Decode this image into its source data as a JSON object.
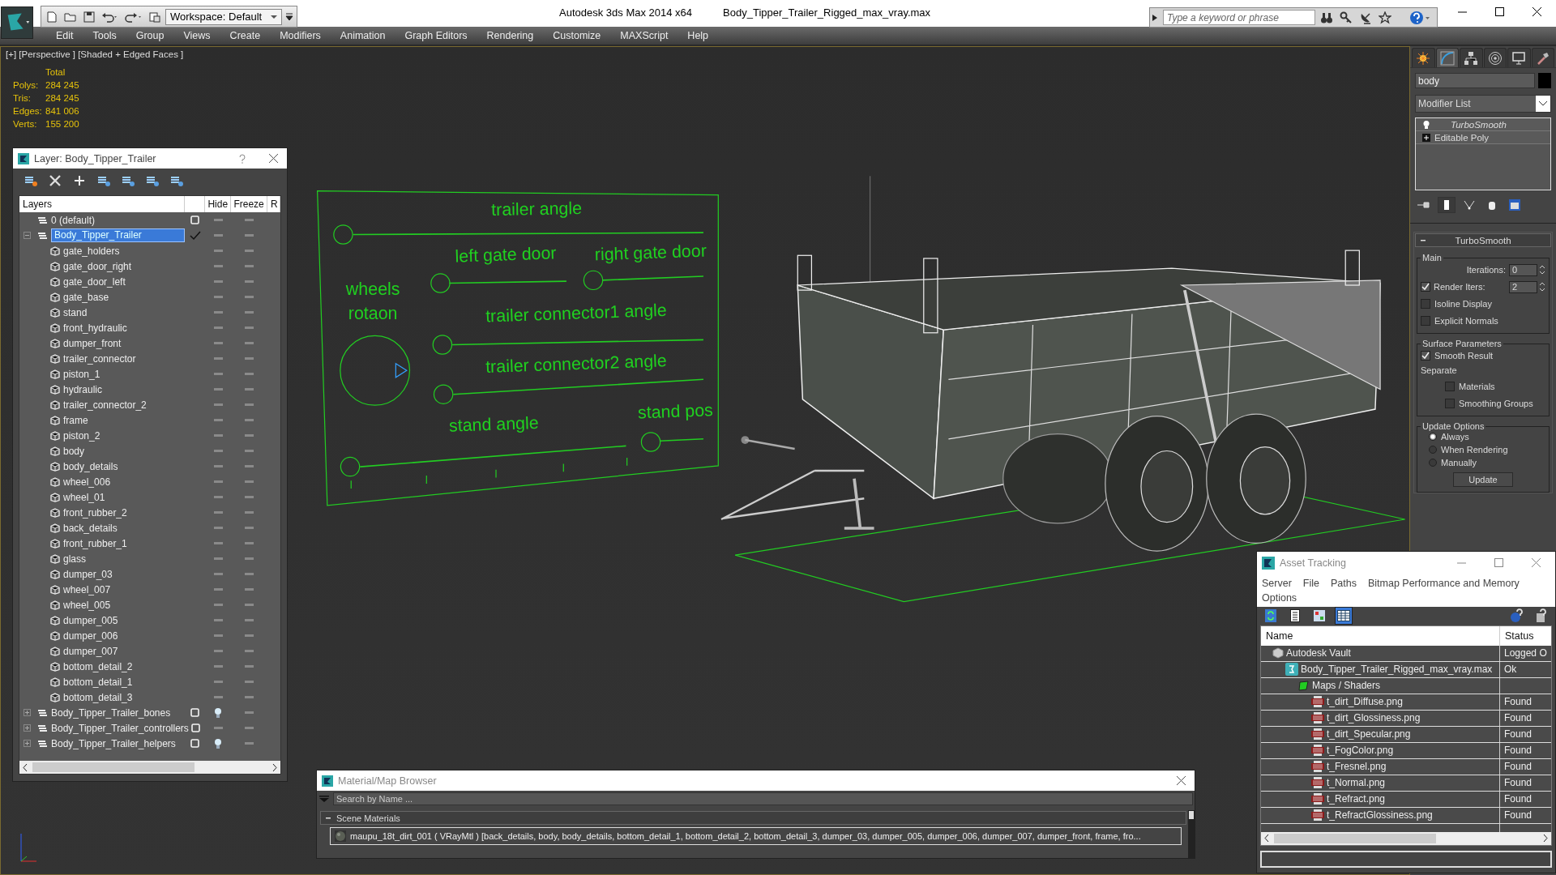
{
  "title_bar": {
    "workspace": "Workspace: Default",
    "app_title": "Autodesk 3ds Max  2014 x64",
    "file_name": "Body_Tipper_Trailer_Rigged_max_vray.max",
    "search_placeholder": "Type a keyword or phrase"
  },
  "menu": [
    "Edit",
    "Tools",
    "Group",
    "Views",
    "Create",
    "Modifiers",
    "Animation",
    "Graph Editors",
    "Rendering",
    "Customize",
    "MAXScript",
    "Help"
  ],
  "viewport": {
    "label": "[+] [Perspective ] [Shaded + Edged Faces ]",
    "stats_header": "Total",
    "stats": [
      {
        "label": "Polys:",
        "value": "284 245"
      },
      {
        "label": "Tris:",
        "value": "284 245"
      },
      {
        "label": "Edges:",
        "value": "841 006"
      },
      {
        "label": "Verts:",
        "value": "155 200"
      }
    ],
    "rig_labels": [
      "trailer angle",
      "left gate door",
      "right gate door",
      "wheels",
      "rotaon",
      "trailer connector1 angle",
      "trailer connector2 angle",
      "stand angle",
      "stand pos"
    ]
  },
  "layer_explorer": {
    "title": "Layer: Body_Tipper_Trailer",
    "columns": [
      "Layers",
      "Hide",
      "Freeze",
      "R"
    ],
    "layers": [
      {
        "name": "0 (default)",
        "current": false,
        "selected": false,
        "hidden": false
      },
      {
        "name": "Body_Tipper_Trailer",
        "expanded": true,
        "current": true,
        "selected": true,
        "hidden": false,
        "children": [
          {
            "name": "gate_holders"
          },
          {
            "name": "gate_door_right"
          },
          {
            "name": "gate_door_left"
          },
          {
            "name": "gate_base"
          },
          {
            "name": "stand"
          },
          {
            "name": "front_hydraulic"
          },
          {
            "name": "dumper_front"
          },
          {
            "name": "trailer_connector"
          },
          {
            "name": "piston_1"
          },
          {
            "name": "hydraulic"
          },
          {
            "name": "trailer_connector_2"
          },
          {
            "name": "frame"
          },
          {
            "name": "piston_2"
          },
          {
            "name": "body"
          },
          {
            "name": "body_details"
          },
          {
            "name": "wheel_006"
          },
          {
            "name": "wheel_01"
          },
          {
            "name": "front_rubber_2"
          },
          {
            "name": "back_details"
          },
          {
            "name": "front_rubber_1"
          },
          {
            "name": "glass"
          },
          {
            "name": "dumper_03"
          },
          {
            "name": "wheel_007"
          },
          {
            "name": "wheel_005"
          },
          {
            "name": "dumper_005"
          },
          {
            "name": "dumper_006"
          },
          {
            "name": "dumper_007"
          },
          {
            "name": "bottom_detail_2"
          },
          {
            "name": "bottom_detail_1"
          },
          {
            "name": "bottom_detail_3"
          }
        ]
      },
      {
        "name": "Body_Tipper_Trailer_bones",
        "expanded": false,
        "current": false,
        "selected": false,
        "hidden": true
      },
      {
        "name": "Body_Tipper_Trailer_controllers",
        "expanded": false,
        "current": false,
        "selected": false,
        "hidden": false
      },
      {
        "name": "Body_Tipper_Trailer_helpers",
        "expanded": false,
        "current": false,
        "selected": false,
        "hidden": true
      }
    ]
  },
  "command_panel": {
    "tabs": [
      {
        "selected": false
      },
      {
        "selected": true
      },
      {
        "selected": false
      },
      {
        "selected": false
      },
      {
        "selected": false
      },
      {
        "selected": false
      }
    ],
    "object_name": "body",
    "modifier_list": "Modifier List",
    "stack": [
      {
        "name": "TurboSmooth",
        "kind": "modifier"
      },
      {
        "name": "Editable Poly",
        "kind": "base"
      }
    ],
    "rollout": {
      "title": "TurboSmooth",
      "main": {
        "title": "Main",
        "iterations_label": "Iterations:",
        "iterations": "0",
        "render_iters": {
          "label": "Render Iters:",
          "checked": true,
          "value": "2"
        },
        "options": [
          {
            "label": "Isoline Display",
            "checked": false
          },
          {
            "label": "Explicit Normals",
            "checked": false
          }
        ]
      },
      "surface": {
        "title": "Surface Parameters",
        "smooth_result": {
          "label": "Smooth Result",
          "checked": true
        },
        "separate_label": "Separate",
        "separate": [
          {
            "label": "Materials",
            "checked": false
          },
          {
            "label": "Smoothing Groups",
            "checked": false
          }
        ]
      },
      "update": {
        "title": "Update Options",
        "options": [
          {
            "label": "Always",
            "selected": true
          },
          {
            "label": "When Rendering",
            "selected": false
          },
          {
            "label": "Manually",
            "selected": false
          }
        ],
        "button": "Update"
      }
    }
  },
  "asset_tracking": {
    "title": "Asset Tracking",
    "menu": [
      "Server",
      "File",
      "Paths",
      "Bitmap Performance and Memory",
      "Options"
    ],
    "toolbar": [
      {
        "selected": false
      },
      {
        "selected": false
      },
      {
        "selected": false
      },
      {
        "selected": true
      }
    ],
    "columns": [
      "Name",
      "Status"
    ],
    "assets": [
      {
        "name": "Autodesk Vault",
        "kind": "vault",
        "status": "Logged O",
        "children": [
          {
            "name": "Body_Tipper_Trailer_Rigged_max_vray.max",
            "kind": "scene",
            "status": "Ok",
            "children": [
              {
                "name": "Maps / Shaders",
                "kind": "folder",
                "children": [
                  {
                    "name": "t_dirt_Diffuse.png",
                    "kind": "png",
                    "status": "Found"
                  },
                  {
                    "name": "t_dirt_Glossiness.png",
                    "kind": "png",
                    "status": "Found"
                  },
                  {
                    "name": "t_dirt_Specular.png",
                    "kind": "png",
                    "status": "Found"
                  },
                  {
                    "name": "t_FogColor.png",
                    "kind": "png",
                    "status": "Found"
                  },
                  {
                    "name": "t_Fresnel.png",
                    "kind": "png",
                    "status": "Found"
                  },
                  {
                    "name": "t_Normal.png",
                    "kind": "png",
                    "status": "Found"
                  },
                  {
                    "name": "t_Refract.png",
                    "kind": "png",
                    "status": "Found"
                  },
                  {
                    "name": "t_RefractGlossiness.png",
                    "kind": "png",
                    "status": "Found"
                  }
                ]
              }
            ]
          }
        ]
      }
    ]
  },
  "material_browser": {
    "title": "Material/Map Browser",
    "search_placeholder": "Search by Name ...",
    "section": {
      "title": "Scene Materials",
      "expanded": true,
      "materials": [
        "maupu_18t_dirt_001 ( VRayMtl ) [back_details, body, body_details, bottom_detail_1, bottom_detail_2, bottom_detail_3, dumper_03, dumper_005, dumper_006, dumper_007, dumper_front, frame, fro..."
      ]
    }
  }
}
